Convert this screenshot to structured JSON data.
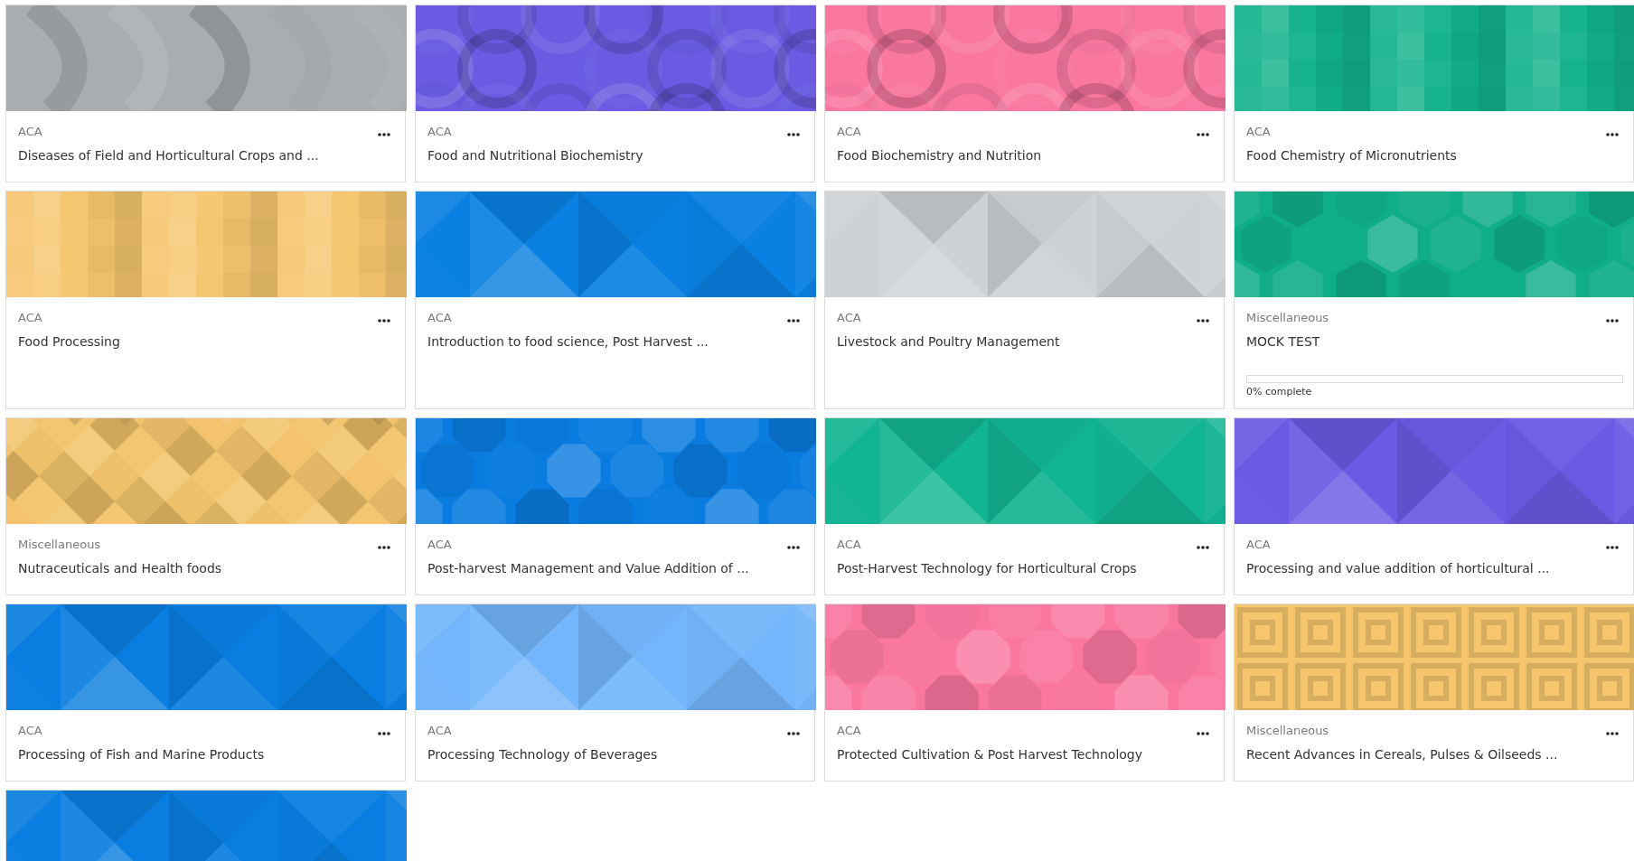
{
  "courses": [
    {
      "category": "ACA",
      "title": "Diseases of Field and Horticultural Crops and ...",
      "color": "#a9adb0",
      "kind": "arcs"
    },
    {
      "category": "ACA",
      "title": "Food and Nutritional Biochemistry",
      "color": "#6a5be2",
      "kind": "circles"
    },
    {
      "category": "ACA",
      "title": "Food Biochemistry and Nutrition",
      "color": "#fa77a0",
      "kind": "circles"
    },
    {
      "category": "ACA",
      "title": "Food Chemistry of Micronutrients",
      "color": "#12b28c",
      "kind": "squares"
    },
    {
      "category": "ACA",
      "title": "Food Processing",
      "color": "#f6c66f",
      "kind": "squares"
    },
    {
      "category": "ACA",
      "title": "Introduction to food science, Post Harvest ...",
      "color": "#0a80e2",
      "kind": "triangles"
    },
    {
      "category": "ACA",
      "title": "Livestock and Poultry Management",
      "color": "#cfd2d5",
      "kind": "triangles"
    },
    {
      "category": "Miscellaneous",
      "title": "MOCK TEST",
      "color": "#0fad88",
      "kind": "hexagons",
      "progress": {
        "level": 0,
        "label": "0% complete"
      }
    },
    {
      "category": "Miscellaneous",
      "title": "Nutraceuticals and Health foods",
      "color": "#f3c46c",
      "kind": "diamonds"
    },
    {
      "category": "ACA",
      "title": "Post-harvest Management and Value Addition of ...",
      "color": "#0a7ce0",
      "kind": "octagons"
    },
    {
      "category": "ACA",
      "title": "Post-Harvest Technology for Horticultural Crops",
      "color": "#12b592",
      "kind": "triangles"
    },
    {
      "category": "ACA",
      "title": "Processing and value addition of horticultural ...",
      "color": "#6b5ae4",
      "kind": "triangles"
    },
    {
      "category": "ACA",
      "title": "Processing of Fish and Marine Products",
      "color": "#0a7ee0",
      "kind": "triangles"
    },
    {
      "category": "ACA",
      "title": "Processing Technology of Beverages",
      "color": "#74b6fb",
      "kind": "triangles"
    },
    {
      "category": "ACA",
      "title": "Protected Cultivation & Post Harvest Technology",
      "color": "#fa77a0",
      "kind": "octagons"
    },
    {
      "category": "Miscellaneous",
      "title": "Recent Advances in Cereals, Pulses & Oilseeds ...",
      "color": "#f5c66e",
      "kind": "concentric"
    },
    {
      "color": "#0a7ee0",
      "kind": "triangles"
    }
  ]
}
